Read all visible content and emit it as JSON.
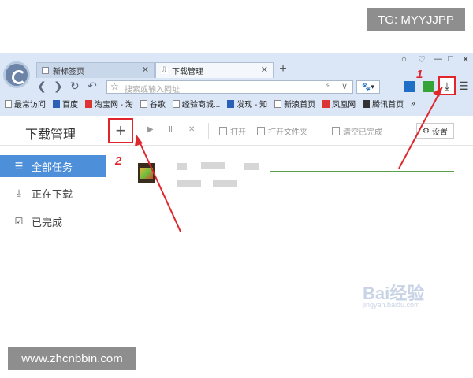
{
  "watermarks": {
    "telegram": "TG: MYYJJPP",
    "site": "www.zhcnbbin.com"
  },
  "browser": {
    "tabs": [
      {
        "label": "新标签页",
        "active": false
      },
      {
        "label": "下载管理",
        "active": true
      }
    ],
    "new_tab_label": "+",
    "window_controls": [
      "⌂",
      "♡",
      "—",
      "□",
      "✕"
    ],
    "address_placeholder": "搜索或输入网址",
    "search_engine_label": "🐾▾",
    "bookmarks": [
      "最常访问",
      "百度",
      "淘宝网 - 淘",
      "谷歌",
      "经验商城...",
      "发现 - 知",
      "新浪首页",
      "凤凰网",
      "腾讯首页",
      "»"
    ]
  },
  "download_manager": {
    "title": "下载管理",
    "add_label": "+",
    "toolbar": {
      "open": "打开",
      "open_folder": "打开文件夹",
      "clear_completed": "清空已完成",
      "settings": "设置"
    },
    "sidebar": [
      {
        "label": "全部任务",
        "icon": "list-icon",
        "active": true
      },
      {
        "label": "正在下载",
        "icon": "download-icon",
        "active": false
      },
      {
        "label": "已完成",
        "icon": "check-icon",
        "active": false
      }
    ]
  },
  "annotations": {
    "marker_1": "1",
    "marker_2": "2"
  },
  "image_watermark": {
    "brand": "Bai经验",
    "sub": "jingyan.baidu.com"
  }
}
